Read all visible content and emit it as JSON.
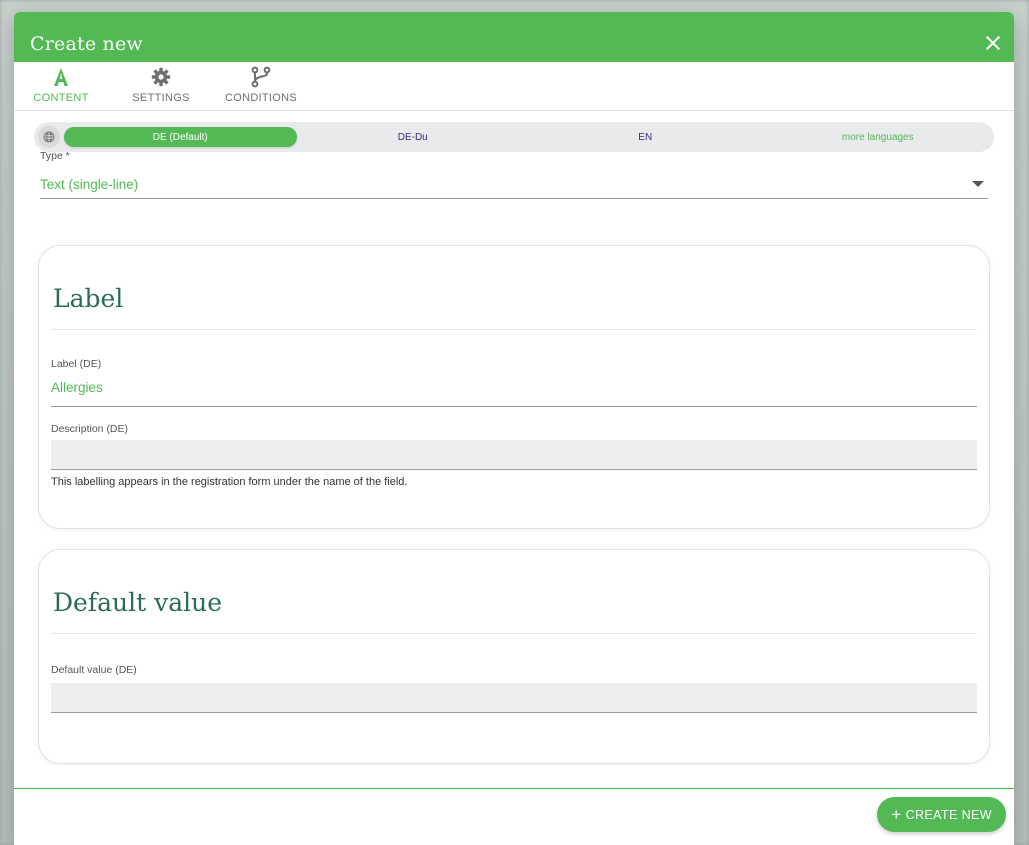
{
  "dialog": {
    "title": "Create new"
  },
  "tabs": [
    {
      "label": "CONTENT",
      "icon": "text-format-icon",
      "active": true
    },
    {
      "label": "SETTINGS",
      "icon": "gear-icon",
      "active": false
    },
    {
      "label": "CONDITIONS",
      "icon": "branch-icon",
      "active": false
    }
  ],
  "languages": {
    "items": [
      "DE (Default)",
      "DE-Du",
      "EN"
    ],
    "more": "more languages",
    "selected": "DE (Default)"
  },
  "type_field": {
    "label": "Type *",
    "value": "Text (single-line)"
  },
  "label_card": {
    "title": "Label",
    "label_field": {
      "label": "Label (DE)",
      "value": "Allergies"
    },
    "description_field": {
      "label": "Description (DE)",
      "value": ""
    },
    "hint": "This labelling appears in the registration form under the name of the field."
  },
  "default_card": {
    "title": "Default value",
    "field": {
      "label": "Default value (DE)",
      "value": ""
    }
  },
  "footer": {
    "create_button": "CREATE NEW"
  },
  "colors": {
    "primary": "#52b955",
    "heading": "#2b6b5a",
    "lang_text": "#3d2a7a"
  }
}
